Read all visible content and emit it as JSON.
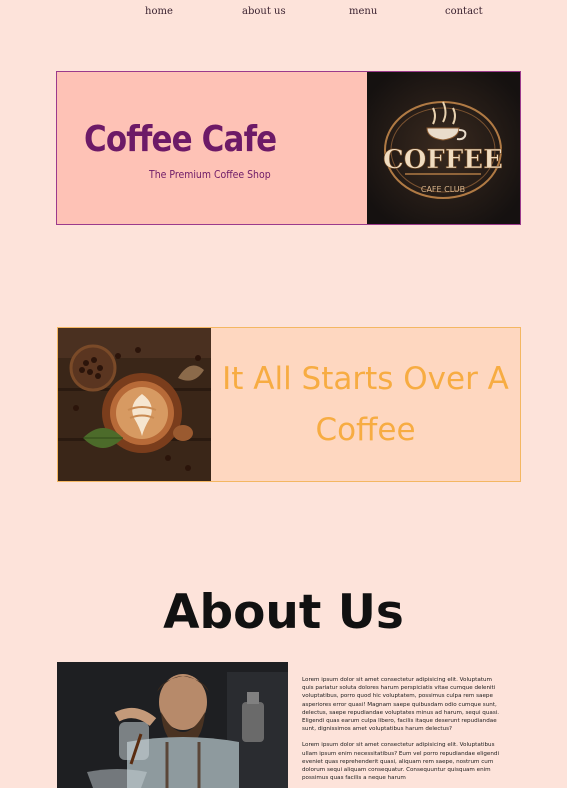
{
  "nav": {
    "items": [
      {
        "label": "home"
      },
      {
        "label": "about us"
      },
      {
        "label": "menu"
      },
      {
        "label": "contact"
      }
    ]
  },
  "hero": {
    "title": "Coffee Cafe",
    "subtitle": "The Premium Coffee Shop",
    "logo_text": "COFFEE",
    "logo_subtext": "CAFE CLUB"
  },
  "banner": {
    "text": "It All Starts Over A Coffee"
  },
  "about": {
    "title": "About Us",
    "paragraphs": [
      "Lorem ipsum dolor sit amet consectetur adipisicing elit. Voluptatum quis pariatur soluta dolores harum perspiciatis vitae cumque deleniti voluptatibus, porro quod hic voluptatem, possimus culpa rem saepe asperiores error quasi! Magnam saepe quibusdam odio cumque sunt, delectus, saepe repudiandae voluptates minus ad harum, sequi quasi. Eligendi quas earum culpa libero, facilis itaque deserunt repudiandae sunt, dignissimos amet voluptatibus harum delectus?",
      "Lorem ipsum dolor sit amet consectetur adipisicing elit. Voluptatibus ullam ipsum enim necessitatibus? Eum vel porro repudiandae eligendi eveniet quas reprehenderit quasi, aliquam rem saepe, nostrum cum dolorum sequi aliquam consequatur. Consequuntur quisquam enim possimus quas facilis a neque harum"
    ]
  },
  "colors": {
    "background": "#fde3da",
    "hero_bg": "#fec2b6",
    "hero_border": "#9b3a8c",
    "title_purple": "#6d1a67",
    "banner_bg": "#fed7c0",
    "banner_border": "#f4b762",
    "banner_text": "#f7ac42"
  }
}
